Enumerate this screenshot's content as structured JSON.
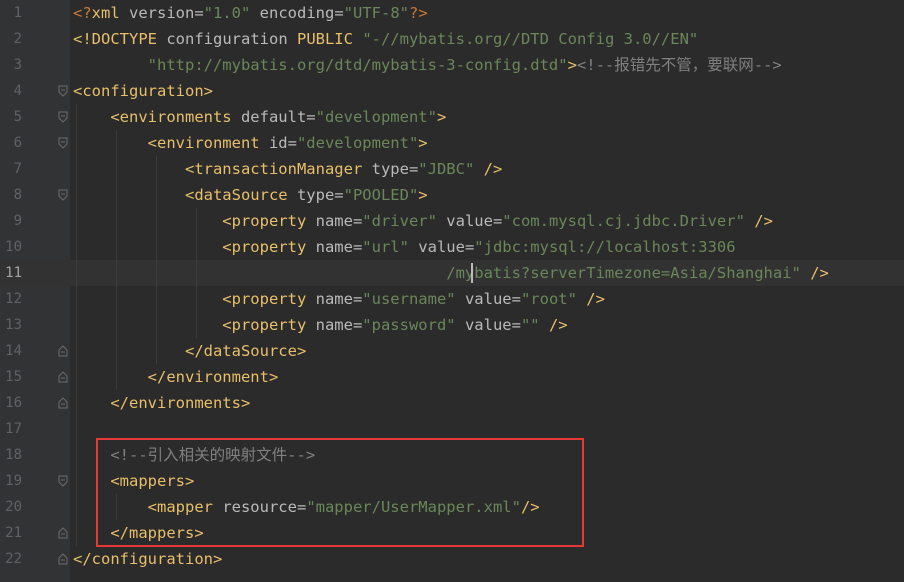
{
  "editor": {
    "language": "xml",
    "current_line": 11,
    "highlight_color": "#e53935",
    "lines": [
      {
        "n": "1",
        "segs": [
          [
            "decl",
            "<?"
          ],
          [
            "tag",
            "xml"
          ],
          [
            "attr",
            " version="
          ],
          [
            "val",
            "\"1.0\""
          ],
          [
            "attr",
            " encoding="
          ],
          [
            "val",
            "\"UTF-8\""
          ],
          [
            "decl",
            "?>"
          ]
        ]
      },
      {
        "n": "2",
        "segs": [
          [
            "tag",
            "<!DOCTYPE"
          ],
          [
            "attr",
            " configuration "
          ],
          [
            "tag",
            "PUBLIC"
          ],
          [
            "val",
            " \"-//mybatis.org//DTD Config 3.0//EN\""
          ]
        ]
      },
      {
        "n": "3",
        "segs": [
          [
            "val",
            "        \"http://mybatis.org/dtd/mybatis-3-config.dtd\""
          ],
          [
            "tag",
            ">"
          ],
          [
            "cmt",
            "<!--报错先不管，要联网-->"
          ]
        ]
      },
      {
        "n": "4",
        "segs": [
          [
            "tag",
            "<configuration>"
          ]
        ]
      },
      {
        "n": "5",
        "segs": [
          [
            "tag",
            "    <environments"
          ],
          [
            "attr",
            " default="
          ],
          [
            "val",
            "\"development\""
          ],
          [
            "tag",
            ">"
          ]
        ]
      },
      {
        "n": "6",
        "segs": [
          [
            "tag",
            "        <environment"
          ],
          [
            "attr",
            " id="
          ],
          [
            "val",
            "\"development\""
          ],
          [
            "tag",
            ">"
          ]
        ]
      },
      {
        "n": "7",
        "segs": [
          [
            "tag",
            "            <transactionManager"
          ],
          [
            "attr",
            " type="
          ],
          [
            "val",
            "\"JDBC\""
          ],
          [
            "tag",
            " />"
          ]
        ]
      },
      {
        "n": "8",
        "segs": [
          [
            "tag",
            "            <dataSource"
          ],
          [
            "attr",
            " type="
          ],
          [
            "val",
            "\"POOLED\""
          ],
          [
            "tag",
            ">"
          ]
        ]
      },
      {
        "n": "9",
        "segs": [
          [
            "tag",
            "                <property"
          ],
          [
            "attr",
            " name="
          ],
          [
            "val",
            "\"driver\""
          ],
          [
            "attr",
            " value="
          ],
          [
            "val",
            "\"com.mysql.cj.jdbc.Driver\""
          ],
          [
            "tag",
            " />"
          ]
        ]
      },
      {
        "n": "10",
        "segs": [
          [
            "tag",
            "                <property"
          ],
          [
            "attr",
            " name="
          ],
          [
            "val",
            "\"url\""
          ],
          [
            "attr",
            " value="
          ],
          [
            "val",
            "\"jdbc:mysql://localhost:3306"
          ]
        ]
      },
      {
        "n": "11",
        "segs": [
          [
            "val",
            "                                        /mybatis?serverTimezone=Asia/Shanghai\""
          ],
          [
            "tag",
            " />"
          ]
        ]
      },
      {
        "n": "12",
        "segs": [
          [
            "tag",
            "                <property"
          ],
          [
            "attr",
            " name="
          ],
          [
            "val",
            "\"username\""
          ],
          [
            "attr",
            " value="
          ],
          [
            "val",
            "\"root\""
          ],
          [
            "tag",
            " />"
          ]
        ]
      },
      {
        "n": "13",
        "segs": [
          [
            "tag",
            "                <property"
          ],
          [
            "attr",
            " name="
          ],
          [
            "val",
            "\"password\""
          ],
          [
            "attr",
            " value="
          ],
          [
            "val",
            "\"\""
          ],
          [
            "tag",
            " />"
          ]
        ]
      },
      {
        "n": "14",
        "segs": [
          [
            "tag",
            "            </dataSource>"
          ]
        ]
      },
      {
        "n": "15",
        "segs": [
          [
            "tag",
            "        </environment>"
          ]
        ]
      },
      {
        "n": "16",
        "segs": [
          [
            "tag",
            "    </environments>"
          ]
        ]
      },
      {
        "n": "17",
        "segs": []
      },
      {
        "n": "18",
        "segs": [
          [
            "cmt",
            "    <!--引入相关的映射文件-->"
          ]
        ]
      },
      {
        "n": "19",
        "segs": [
          [
            "tag",
            "    <mappers>"
          ]
        ]
      },
      {
        "n": "20",
        "segs": [
          [
            "tag",
            "        <mapper"
          ],
          [
            "attr",
            " resource="
          ],
          [
            "val",
            "\"mapper/UserMapper.xml\""
          ],
          [
            "tag",
            "/>"
          ]
        ]
      },
      {
        "n": "21",
        "segs": [
          [
            "tag",
            "    </mappers>"
          ]
        ]
      },
      {
        "n": "22",
        "segs": [
          [
            "tag",
            "</configuration>"
          ]
        ]
      }
    ]
  }
}
